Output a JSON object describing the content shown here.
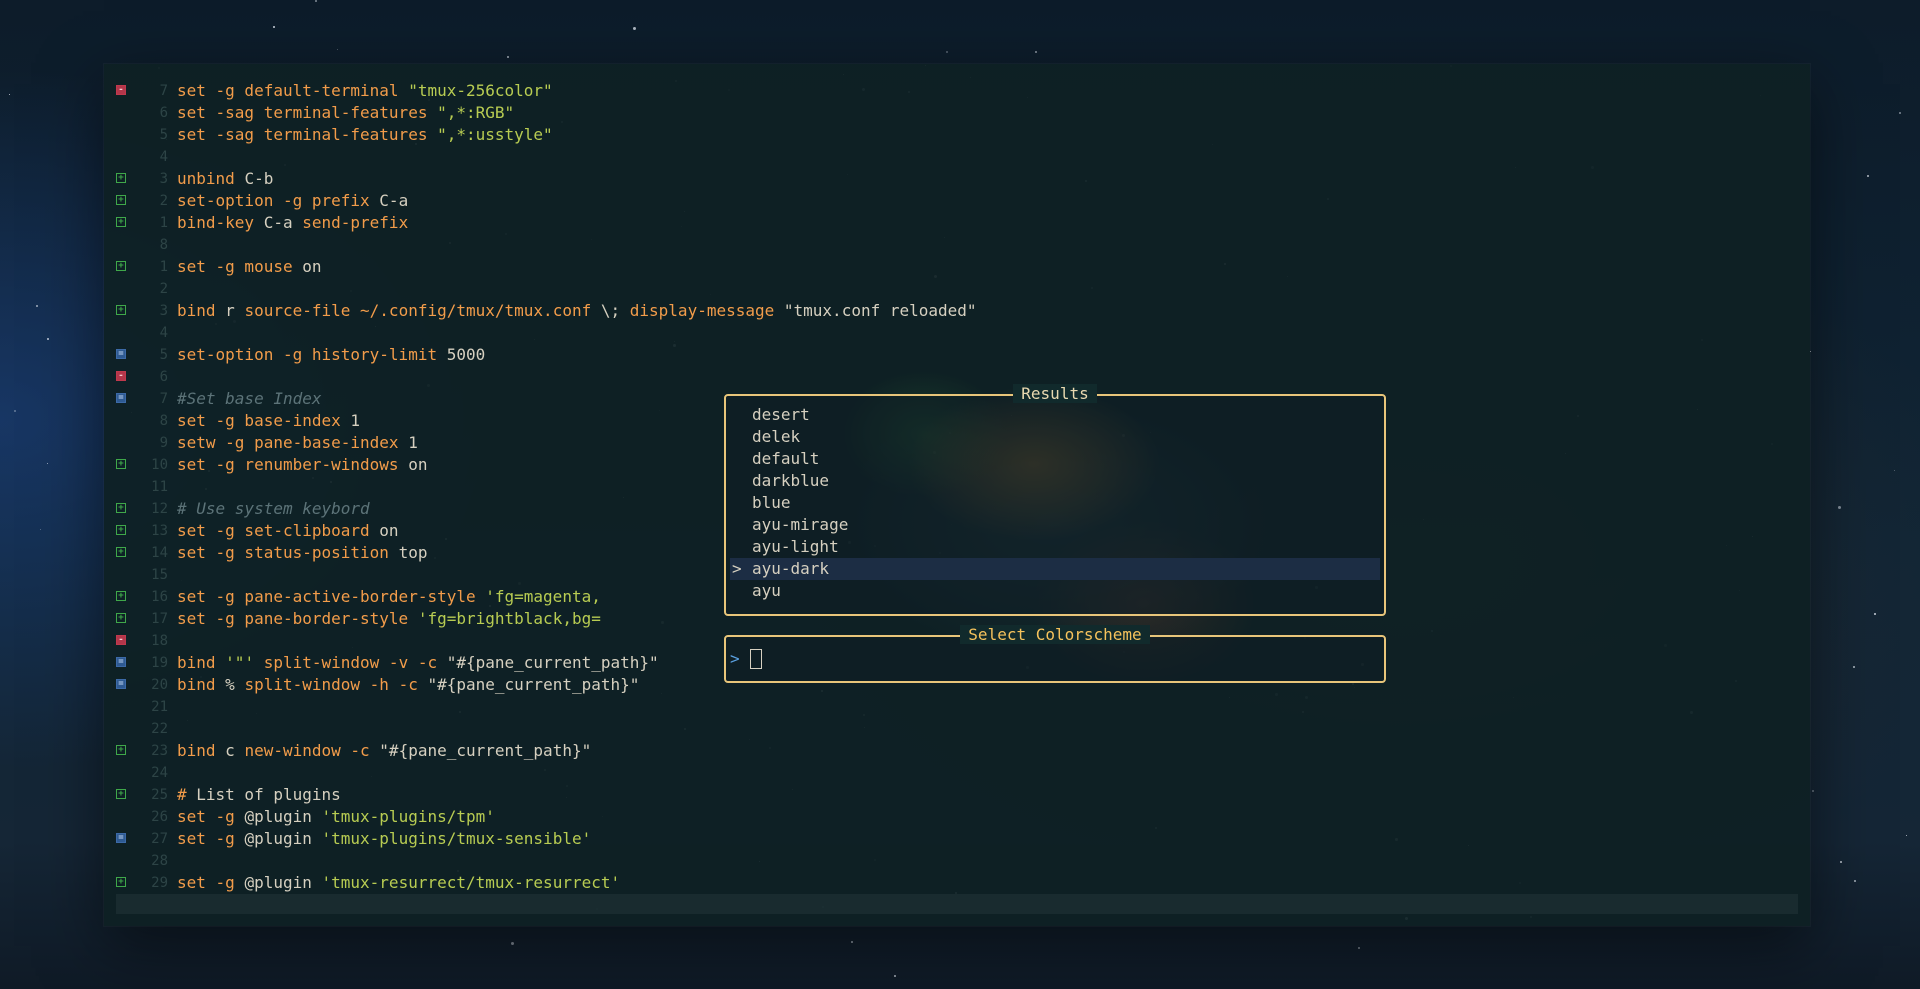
{
  "editor": {
    "lines": [
      {
        "n": "7",
        "sign": "del",
        "segs": [
          [
            "kw",
            "set -g default-terminal "
          ],
          [
            "str",
            "\"tmux-256color\""
          ]
        ]
      },
      {
        "n": "6",
        "sign": "",
        "segs": [
          [
            "kw",
            "set -sag terminal-features "
          ],
          [
            "str",
            "\",*:RGB\""
          ]
        ]
      },
      {
        "n": "5",
        "sign": "",
        "segs": [
          [
            "kw",
            "set -sag terminal-features "
          ],
          [
            "str",
            "\",*:usstyle\""
          ]
        ]
      },
      {
        "n": "4",
        "sign": "",
        "segs": []
      },
      {
        "n": "3",
        "sign": "add",
        "segs": [
          [
            "kw",
            "unbind "
          ],
          [
            "t",
            "C-b"
          ]
        ]
      },
      {
        "n": "2",
        "sign": "add",
        "segs": [
          [
            "kw",
            "set-option -g prefix "
          ],
          [
            "t",
            "C-a"
          ]
        ]
      },
      {
        "n": "1",
        "sign": "add",
        "segs": [
          [
            "kw",
            "bind-key "
          ],
          [
            "t",
            "C-a "
          ],
          [
            "kw",
            "send-prefix"
          ]
        ]
      },
      {
        "n": "8",
        "sign": "",
        "segs": []
      },
      {
        "n": "1",
        "sign": "add",
        "segs": [
          [
            "kw",
            "set -g mouse "
          ],
          [
            "t",
            "on"
          ]
        ]
      },
      {
        "n": "2",
        "sign": "",
        "segs": []
      },
      {
        "n": "3",
        "sign": "add",
        "segs": [
          [
            "kw",
            "bind "
          ],
          [
            "t",
            "r "
          ],
          [
            "kw",
            "source-file ~/.config/tmux/tmux.conf "
          ],
          [
            "t",
            "\\; "
          ],
          [
            "kw",
            "display-message "
          ],
          [
            "t",
            "\"tmux.conf reloaded\""
          ]
        ]
      },
      {
        "n": "4",
        "sign": "",
        "segs": []
      },
      {
        "n": "5",
        "sign": "chg",
        "segs": [
          [
            "kw",
            "set-option -g history-limit "
          ],
          [
            "t",
            "5000"
          ]
        ]
      },
      {
        "n": "6",
        "sign": "del",
        "segs": []
      },
      {
        "n": "7",
        "sign": "chg",
        "segs": [
          [
            "cm",
            "#Set base Index"
          ]
        ]
      },
      {
        "n": "8",
        "sign": "",
        "segs": [
          [
            "kw",
            "set -g base-index "
          ],
          [
            "t",
            "1"
          ]
        ]
      },
      {
        "n": "9",
        "sign": "",
        "segs": [
          [
            "kw",
            "setw -g pane-base-index "
          ],
          [
            "t",
            "1"
          ]
        ]
      },
      {
        "n": "10",
        "sign": "add",
        "segs": [
          [
            "kw",
            "set -g renumber-windows "
          ],
          [
            "t",
            "on"
          ]
        ]
      },
      {
        "n": "11",
        "sign": "",
        "segs": []
      },
      {
        "n": "12",
        "sign": "add",
        "segs": [
          [
            "cm",
            "# Use system keybord"
          ]
        ]
      },
      {
        "n": "13",
        "sign": "add",
        "segs": [
          [
            "kw",
            "set -g set-clipboard "
          ],
          [
            "t",
            "on"
          ]
        ]
      },
      {
        "n": "14",
        "sign": "add",
        "segs": [
          [
            "kw",
            "set -g status-position "
          ],
          [
            "t",
            "top"
          ]
        ]
      },
      {
        "n": "15",
        "sign": "",
        "segs": []
      },
      {
        "n": "16",
        "sign": "add",
        "segs": [
          [
            "kw",
            "set -g pane-active-border-style "
          ],
          [
            "str",
            "'fg=magenta,"
          ]
        ]
      },
      {
        "n": "17",
        "sign": "add",
        "segs": [
          [
            "kw",
            "set -g pane-border-style "
          ],
          [
            "str",
            "'fg=brightblack,bg="
          ]
        ]
      },
      {
        "n": "18",
        "sign": "del",
        "segs": []
      },
      {
        "n": "19",
        "sign": "chg",
        "segs": [
          [
            "kw",
            "bind "
          ],
          [
            "str",
            "'\"' "
          ],
          [
            "kw",
            "split-window -v -c "
          ],
          [
            "t",
            "\"#{pane_current_path}\""
          ]
        ]
      },
      {
        "n": "20",
        "sign": "chg",
        "segs": [
          [
            "kw",
            "bind "
          ],
          [
            "t",
            "% "
          ],
          [
            "kw",
            "split-window -h -c "
          ],
          [
            "t",
            "\"#{pane_current_path}\""
          ]
        ]
      },
      {
        "n": "21",
        "sign": "",
        "segs": []
      },
      {
        "n": "22",
        "sign": "",
        "segs": []
      },
      {
        "n": "23",
        "sign": "add",
        "segs": [
          [
            "kw",
            "bind "
          ],
          [
            "t",
            "c "
          ],
          [
            "kw",
            "new-window -c "
          ],
          [
            "t",
            "\"#{pane_current_path}\""
          ]
        ]
      },
      {
        "n": "24",
        "sign": "",
        "segs": []
      },
      {
        "n": "25",
        "sign": "add",
        "segs": [
          [
            "kw",
            "# "
          ],
          [
            "t",
            "List of plugins"
          ]
        ]
      },
      {
        "n": "26",
        "sign": "",
        "segs": [
          [
            "kw",
            "set -g "
          ],
          [
            "t",
            "@plugin "
          ],
          [
            "str",
            "'tmux-plugins/tpm'"
          ]
        ]
      },
      {
        "n": "27",
        "sign": "chg",
        "segs": [
          [
            "kw",
            "set -g "
          ],
          [
            "t",
            "@plugin "
          ],
          [
            "str",
            "'tmux-plugins/tmux-sensible'"
          ]
        ]
      },
      {
        "n": "28",
        "sign": "",
        "segs": []
      },
      {
        "n": "29",
        "sign": "add",
        "segs": [
          [
            "kw",
            "set -g "
          ],
          [
            "t",
            "@plugin "
          ],
          [
            "str",
            "'tmux-resurrect/tmux-resurrect'"
          ]
        ]
      }
    ]
  },
  "results": {
    "title": "Results",
    "items": [
      "desert",
      "delek",
      "default",
      "darkblue",
      "blue",
      "ayu-mirage",
      "ayu-light",
      "ayu-dark",
      "ayu"
    ],
    "selected_index": 7,
    "selection_marker": ">"
  },
  "prompt": {
    "title": "Select Colorscheme",
    "symbol": ">",
    "value": ""
  },
  "colors": {
    "keyword": "#f29c4a",
    "string": "#b8cc52",
    "comment": "#5c7378",
    "popup_border": "#e8c57a",
    "selection_bg": "#1c2d44"
  }
}
